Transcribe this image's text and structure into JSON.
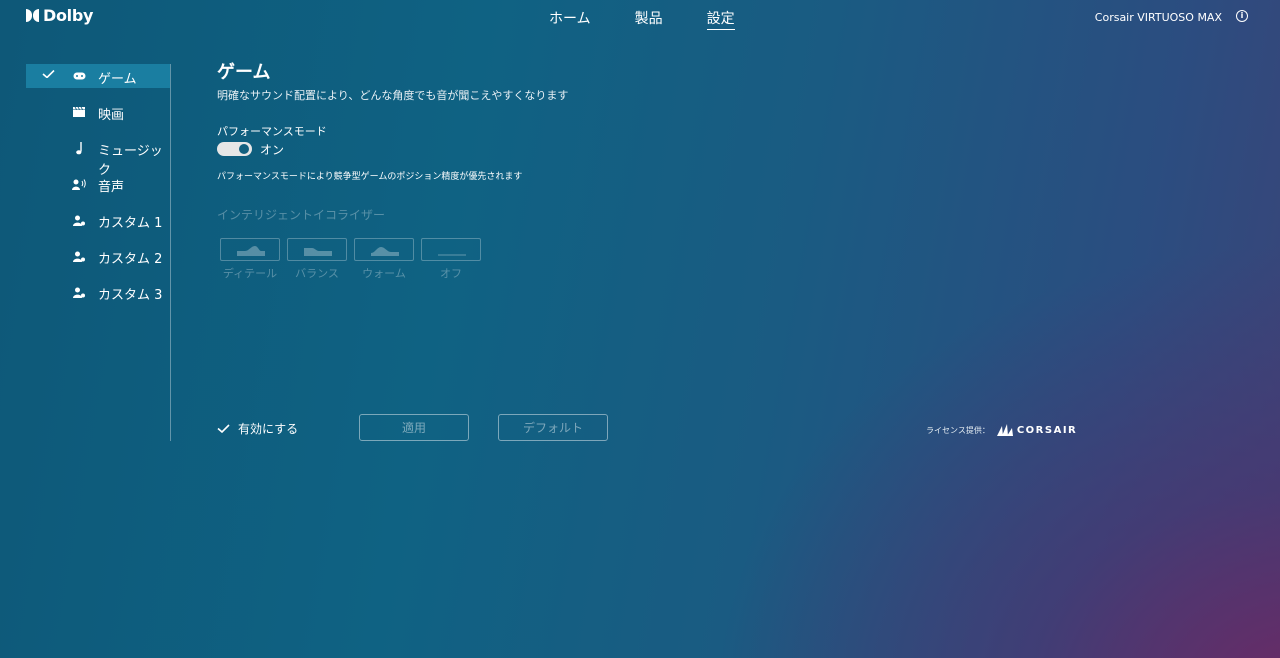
{
  "header": {
    "logo_text": "Dolby",
    "nav": [
      "ホーム",
      "製品",
      "設定"
    ],
    "active_nav": "設定",
    "device_name": "Corsair VIRTUOSO MAX",
    "info_icon": "info-icon"
  },
  "sidebar": {
    "items": [
      {
        "label": "ゲーム",
        "icon": "gamepad-icon",
        "selected": true
      },
      {
        "label": "映画",
        "icon": "clapperboard-icon",
        "selected": false
      },
      {
        "label": "ミュージック",
        "icon": "music-note-icon",
        "selected": false
      },
      {
        "label": "音声",
        "icon": "voice-icon",
        "selected": false
      },
      {
        "label": "カスタム 1",
        "icon": "custom-user-icon",
        "selected": false
      },
      {
        "label": "カスタム 2",
        "icon": "custom-user-icon",
        "selected": false
      },
      {
        "label": "カスタム 3",
        "icon": "custom-user-icon",
        "selected": false
      }
    ]
  },
  "main": {
    "title": "ゲーム",
    "description": "明確なサウンド配置により、どんな角度でも音が聞こえやすくなります",
    "performance": {
      "label": "パフォーマンスモード",
      "state": "オン",
      "enabled": true,
      "note": "パフォーマンスモードにより競争型ゲームのポジション精度が優先されます"
    },
    "equalizer": {
      "label": "インテリジェントイコライザー",
      "presets": [
        "ディテール",
        "バランス",
        "ウォーム",
        "オフ"
      ]
    }
  },
  "footer": {
    "enable_label": "有効にする",
    "apply_label": "適用",
    "default_label": "デフォルト",
    "license_label": "ライセンス提供：",
    "license_brand": "CORSAIR"
  }
}
